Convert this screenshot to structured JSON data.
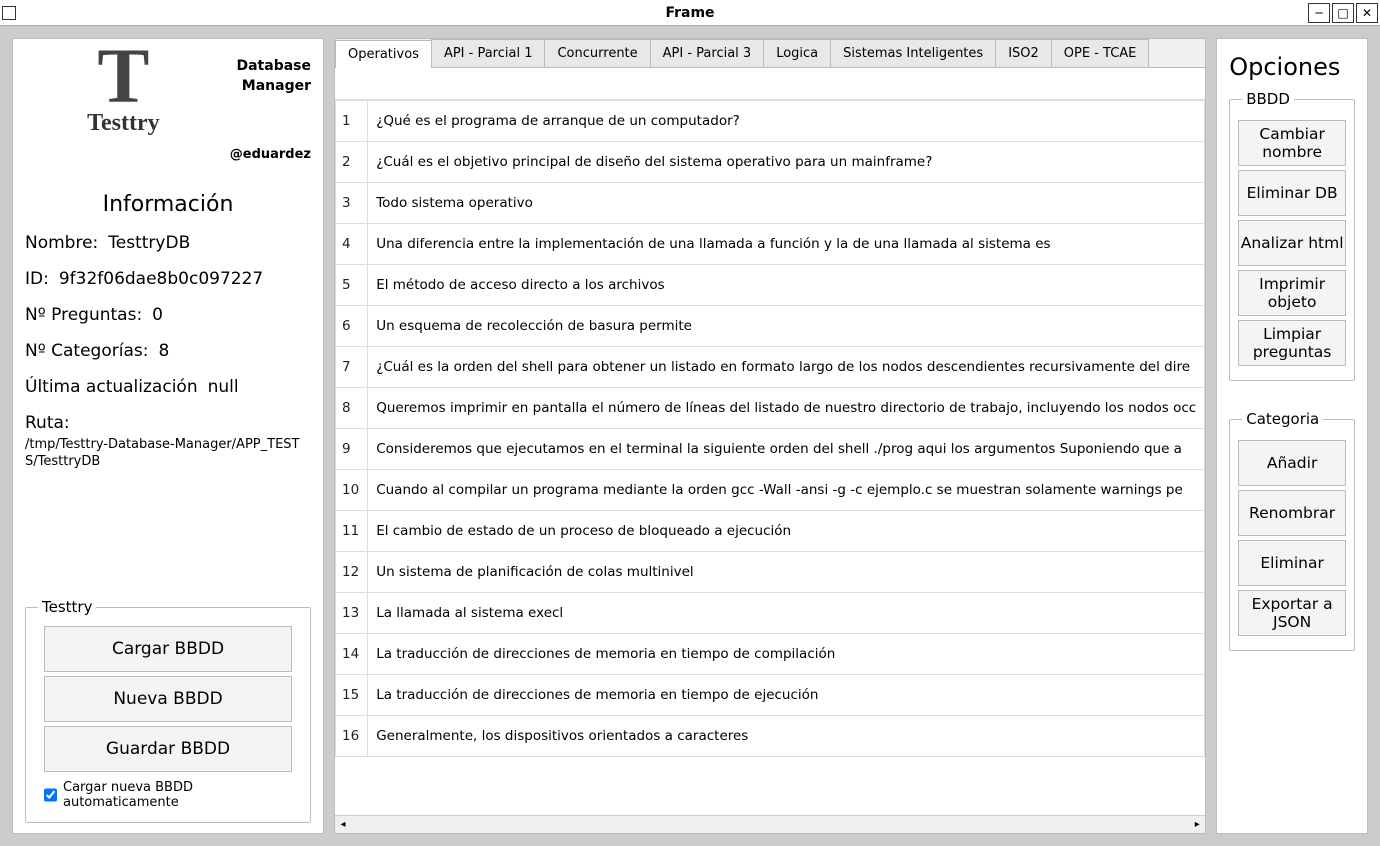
{
  "window": {
    "title": "Frame"
  },
  "brand": {
    "name": "Testtry",
    "app": "Database\nManager",
    "handle": "@eduardez"
  },
  "info": {
    "heading": "Información",
    "name_label": "Nombre:",
    "name_value": "TesttryDB",
    "id_label": "ID:",
    "id_value": "9f32f06dae8b0c097227",
    "nq_label": "Nº Preguntas:",
    "nq_value": "0",
    "nc_label": "Nº Categorías:",
    "nc_value": "8",
    "upd_label": "Última actualización",
    "upd_value": "null",
    "path_label": "Ruta:",
    "path_value": "/tmp/Testtry-Database-Manager/APP_TESTS/TesttryDB"
  },
  "testtry_box": {
    "legend": "Testtry",
    "load": "Cargar BBDD",
    "new": "Nueva BBDD",
    "save": "Guardar BBDD",
    "auto_label": "Cargar nueva BBDD automaticamente",
    "auto_checked": true
  },
  "tabs": [
    "Operativos",
    "API - Parcial 1",
    "Concurrente",
    "API - Parcial 3",
    "Logica",
    "Sistemas Inteligentes",
    "ISO2",
    "OPE - TCAE"
  ],
  "active_tab": 0,
  "questions": [
    "¿Qué es el programa de arranque de un computador?",
    "¿Cuál es el objetivo principal de diseño del sistema operativo para un mainframe?",
    "Todo sistema operativo",
    "Una diferencia entre la implementación de una llamada a función y la de una llamada al sistema es",
    "El método de acceso directo a los archivos",
    "Un esquema de recolección de basura permite",
    "¿Cuál es la orden del shell para obtener un listado en formato largo de los nodos descendientes recursivamente del dire",
    "Queremos imprimir en pantalla el número de líneas del listado de nuestro directorio de trabajo, incluyendo los nodos occ",
    "Consideremos que ejecutamos en el terminal la siguiente orden del shell  ./prog aqui los argumentos  Suponiendo que a",
    "Cuando al compilar un programa mediante la orden  gcc -Wall -ansi -g -c ejemplo.c  se muestran solamente warnings pe",
    "El cambio de estado de un proceso de bloqueado a ejecución",
    "Un sistema de planificación de colas multinivel",
    "La llamada al sistema execl",
    "La traducción de direcciones de memoria en tiempo de compilación",
    "La traducción de direcciones de memoria en tiempo de ejecución",
    "Generalmente, los dispositivos orientados a caracteres"
  ],
  "options": {
    "heading": "Opciones",
    "bbdd_legend": "BBDD",
    "bbdd_buttons": [
      "Cambiar nombre",
      "Eliminar DB",
      "Analizar html",
      "Imprimir objeto",
      "Limpiar preguntas"
    ],
    "cat_legend": "Categoria",
    "cat_buttons": [
      "Añadir",
      "Renombrar",
      "Eliminar",
      "Exportar a JSON"
    ]
  }
}
